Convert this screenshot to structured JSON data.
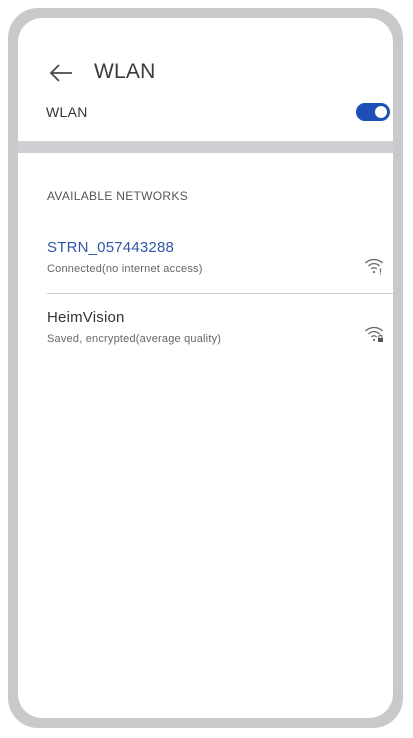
{
  "header": {
    "title": "WLAN",
    "back_icon": "arrow-left-icon"
  },
  "wlan": {
    "label": "WLAN",
    "enabled": true,
    "toggle_color": "#1f4fb6"
  },
  "networks": {
    "section_title": "AVAILABLE NETWORKS",
    "items": [
      {
        "name": "STRN_057443288",
        "status": "Connected(no internet access)",
        "icon": "wifi-no-internet-icon",
        "name_color": "#2f55a8"
      },
      {
        "name": "HeimVision",
        "status": "Saved, encrypted(average quality)",
        "icon": "wifi-locked-icon",
        "name_color": "#333333"
      }
    ]
  }
}
